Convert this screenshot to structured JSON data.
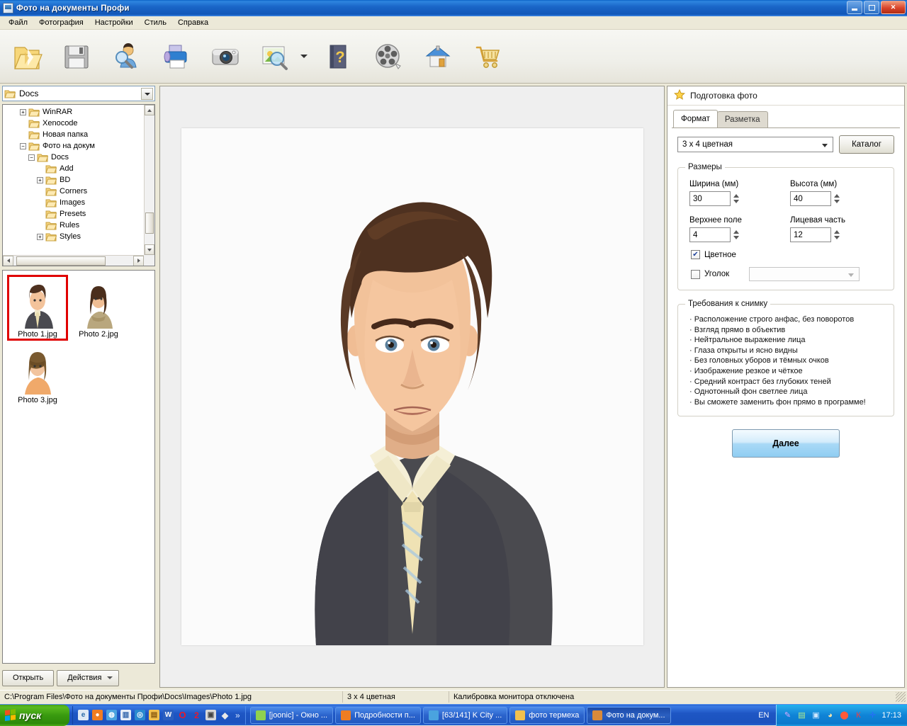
{
  "window": {
    "title": "Фото на документы Профи",
    "icon": "app-photo-icon",
    "controls": {
      "minimize": "minimize-icon",
      "restore": "restore-icon",
      "close": "close-icon"
    }
  },
  "menu": {
    "items": [
      {
        "label": "Файл"
      },
      {
        "label": "Фотография"
      },
      {
        "label": "Настройки"
      },
      {
        "label": "Стиль"
      },
      {
        "label": "Справка"
      }
    ]
  },
  "toolbar": {
    "buttons": [
      {
        "name": "open-folder-button",
        "icon": "open-folder-icon"
      },
      {
        "name": "save-button",
        "icon": "floppy-save-icon"
      },
      {
        "name": "find-person-button",
        "icon": "person-search-icon"
      },
      {
        "name": "print-button",
        "icon": "printer-icon"
      },
      {
        "name": "camera-button",
        "icon": "camera-icon"
      },
      {
        "name": "preview-button",
        "icon": "image-magnifier-icon"
      },
      {
        "name": "help-button",
        "icon": "help-book-icon"
      },
      {
        "name": "video-button",
        "icon": "film-reel-icon"
      },
      {
        "name": "home-button",
        "icon": "home-icon"
      },
      {
        "name": "buy-button",
        "icon": "shopping-cart-icon"
      }
    ]
  },
  "explorer": {
    "current_folder": "Docs",
    "tree": [
      {
        "label": "WinRAR",
        "indent": 3,
        "expander": "+",
        "depth_guides": 3
      },
      {
        "label": "Xenocode",
        "indent": 3,
        "expander": "",
        "depth_guides": 3
      },
      {
        "label": "Новая папка",
        "indent": 3,
        "expander": "",
        "depth_guides": 3
      },
      {
        "label": "Фото на докум",
        "indent": 3,
        "expander": "−",
        "depth_guides": 3
      },
      {
        "label": "Docs",
        "indent": 4,
        "expander": "−",
        "depth_guides": 4
      },
      {
        "label": "Add",
        "indent": 5,
        "expander": "",
        "depth_guides": 5
      },
      {
        "label": "BD",
        "indent": 5,
        "expander": "+",
        "depth_guides": 5
      },
      {
        "label": "Corners",
        "indent": 5,
        "expander": "",
        "depth_guides": 5
      },
      {
        "label": "Images",
        "indent": 5,
        "expander": "",
        "depth_guides": 5
      },
      {
        "label": "Presets",
        "indent": 5,
        "expander": "",
        "depth_guides": 5
      },
      {
        "label": "Rules",
        "indent": 5,
        "expander": "",
        "depth_guides": 5
      },
      {
        "label": "Styles",
        "indent": 5,
        "expander": "+",
        "depth_guides": 5
      }
    ],
    "thumbnails": [
      {
        "caption": "Photo 1.jpg",
        "selected": true
      },
      {
        "caption": "Photo 2.jpg",
        "selected": false
      },
      {
        "caption": "Photo 3.jpg",
        "selected": false
      }
    ],
    "buttons": {
      "open": "Открыть",
      "actions": "Действия"
    }
  },
  "panel": {
    "header": "Подготовка фото",
    "header_icon": "star-icon",
    "tabs": [
      {
        "label": "Формат",
        "active": true
      },
      {
        "label": "Разметка",
        "active": false
      }
    ],
    "format_select": {
      "value": "3 x 4 цветная"
    },
    "catalog_button": "Каталог",
    "sizes": {
      "legend": "Размеры",
      "width": {
        "label": "Ширина (мм)",
        "value": "30"
      },
      "height": {
        "label": "Высота (мм)",
        "value": "40"
      },
      "top_margin": {
        "label": "Верхнее поле",
        "value": "4"
      },
      "face_part": {
        "label": "Лицевая часть",
        "value": "12"
      },
      "color_checkbox": {
        "label": "Цветное",
        "checked": true
      },
      "corner_checkbox": {
        "label": "Уголок",
        "checked": false
      },
      "corner_select_value": ""
    },
    "requirements": {
      "legend": "Требования к снимку",
      "items": [
        "· Расположение строго анфас, без поворотов",
        "· Взгляд прямо в объектив",
        "· Нейтральное выражение лица",
        "· Глаза открыты и ясно видны",
        "· Без головных уборов и тёмных очков",
        "· Изображение резкое и чёткое",
        "· Средний контраст без глубоких теней",
        "· Однотонный фон светлее лица",
        "· Вы сможете заменить фон прямо в программе!"
      ]
    },
    "next_button": "Далее"
  },
  "statusbar": {
    "path": "C:\\Program Files\\Фото на документы Профи\\Docs\\Images\\Photo 1.jpg",
    "format": "3 x 4 цветная",
    "calibration": "Калибровка монитора отключена"
  },
  "taskbar": {
    "start": "пуск",
    "quicklaunch_more": "»",
    "tasks": [
      {
        "label": "[joonic] - Окно ...",
        "icon_color": "#8fd14f",
        "active": false
      },
      {
        "label": "Подробности п...",
        "icon_color": "#ef7d22",
        "active": false
      },
      {
        "label": "[63/141] K City ...",
        "icon_color": "#4aa3df",
        "active": false
      },
      {
        "label": "фото термеха",
        "icon_color": "#f2c14e",
        "active": false
      },
      {
        "label": "Фото на докум...",
        "icon_color": "#d98a3a",
        "active": true
      }
    ],
    "language": "EN",
    "clock": "17:13"
  },
  "colors": {
    "titlebar_blue": "#1a66c8",
    "selection_red": "#e00000",
    "accent_button": "#a9d9f6",
    "taskbar_blue": "#1e56c4",
    "start_green": "#399a0f"
  }
}
